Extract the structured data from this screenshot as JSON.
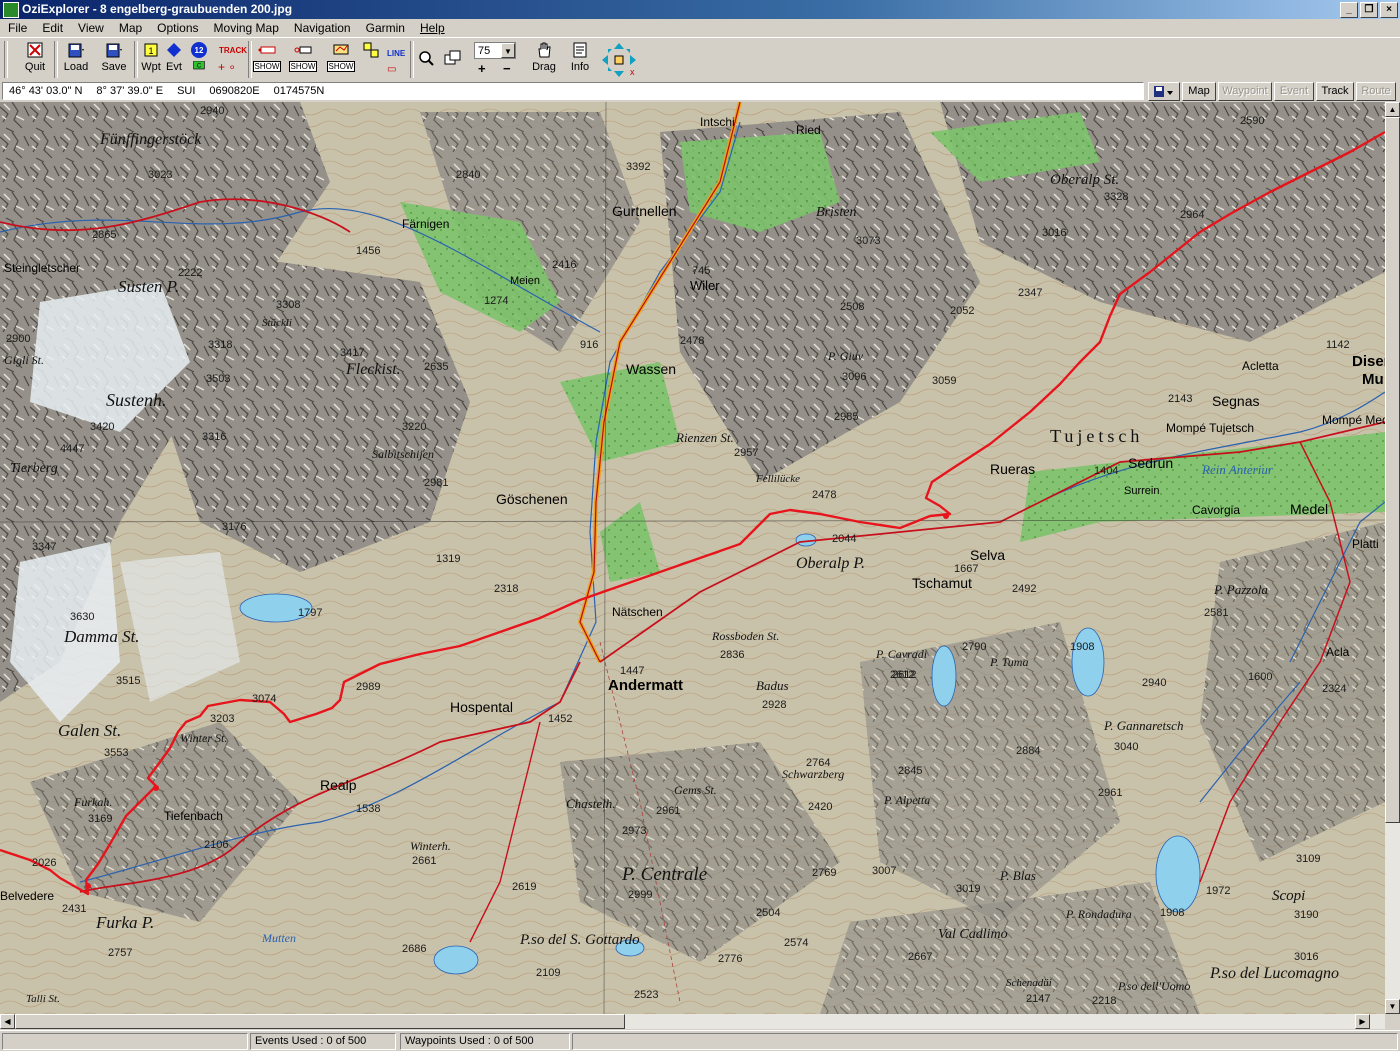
{
  "window": {
    "title": "OziExplorer - 8 engelberg-graubuenden 200.jpg"
  },
  "menu": [
    "File",
    "Edit",
    "View",
    "Map",
    "Options",
    "Moving Map",
    "Navigation",
    "Garmin",
    "Help"
  ],
  "toolbar": {
    "quit": "Quit",
    "load": "Load",
    "save": "Save",
    "wpt": "Wpt",
    "evt": "Evt",
    "track": "TRACK",
    "badge": "12",
    "show": "SHOW",
    "line": "LINE",
    "zoom": "75",
    "drag": "Drag",
    "info": "Info"
  },
  "coords": {
    "lat": "46° 43' 03.0\" N",
    "lon": "8° 37' 39.0\" E",
    "grid": "SUI",
    "east": "0690820E",
    "north": "0174575N"
  },
  "modes": {
    "map": "Map",
    "waypoint": "Waypoint",
    "event": "Event",
    "track": "Track",
    "route": "Route"
  },
  "status": {
    "events": "Events Used : 0 of 500",
    "waypoints": "Waypoints Used : 0 of 500"
  },
  "colors": {
    "track": "#e8141c",
    "titlebar": "#0a246a",
    "lake": "#8fd0ec",
    "forest": "#7dc36b"
  },
  "map": {
    "places": {
      "funffinger": "Fünffingerstöck",
      "steingletscher": "Steingletscher",
      "susten_p": "Susten P.",
      "gigli": "Gigli St.",
      "sustenh": "Sustenh.",
      "tierberg": "Tierberg",
      "farnigen": "Färnigen",
      "meien": "Meien",
      "fleckist": "Fleckist.",
      "intschi": "Intschi",
      "ried": "Ried",
      "gurtnellen": "Gurtnellen",
      "wiler": "Wiler",
      "wassen": "Wassen",
      "goschenen": "Göschenen",
      "sustli": "Stückli",
      "salbitschijen": "Salbitschijen",
      "damma": "Damma St.",
      "galen": "Galen St.",
      "winter": "Winter St.",
      "furkah": "Furkah.",
      "tiefenbach": "Tiefenbach",
      "realp": "Realp",
      "hospental": "Hospental",
      "andermatt": "Andermatt",
      "natschen": "Nätschen",
      "oberalp": "Oberalp P.",
      "tschamut": "Tschamut",
      "selva": "Selva",
      "rueras": "Rueras",
      "sedrun": "Sedrun",
      "surrein": "Surrein",
      "cavorgia": "Cavorgia",
      "medel": "Medel",
      "segnas": "Segnas",
      "acletta": "Acletta",
      "mompe_tujetsch": "Mompé Tujetsch",
      "mompe_medel": "Mompé Med.",
      "disentis": "Disentis",
      "mu": "Mu",
      "tujetsch": "Tujetsch",
      "furka": "Furka P.",
      "belvedere": "Belvedere",
      "winterh": "Winterh.",
      "chastelhorn": "Chastelh.",
      "gemsst": "Gems St.",
      "p_centrale": "P. Centrale",
      "gottardo": "P.so del S. Gottardo",
      "rossboden": "Rossboden St.",
      "badus": "Badus",
      "schwarzberg": "Schwarzberg",
      "p_alpetta": "P. Alpetta",
      "p_cavradi": "P. Cavradi",
      "p_tuma": "P. Tuma",
      "p_gannaretsch": "P. Gannaretsch",
      "p_pazzola": "P. Pazzola",
      "p_blas": "P. Blas",
      "platti": "Platti",
      "acla": "Acla",
      "scopi": "Scopi",
      "lucomagno": "P.so del Lucomagno",
      "rein": "Rein Anteriur",
      "oberalp_st": "Oberalp St.",
      "p_giuv": "P. Giuv",
      "rienzen": "Rienzen St.",
      "fellilucke": "Fellilücke",
      "muttenhorn": "Mutten",
      "val_cadlimo": "Val Cadlimo",
      "tallist": "Talli St.",
      "pdellomo": "P.so dell'Uomo",
      "schenadui": "Schenadüi",
      "rondadura": "P. Rondadura",
      "bristen": "Bristen"
    },
    "elev": [
      "2940",
      "3023",
      "2865",
      "2222",
      "2900",
      "3318",
      "3308",
      "1456",
      "1274",
      "3417",
      "2635",
      "3503",
      "3316",
      "3420",
      "4447",
      "3220",
      "2981",
      "3176",
      "3347",
      "1319",
      "1797",
      "2318",
      "3630",
      "2989",
      "3515",
      "3074",
      "3203",
      "3553",
      "3169",
      "2431",
      "2026",
      "2757",
      "1538",
      "2106",
      "1447",
      "1452",
      "2961",
      "2973",
      "2999",
      "2661",
      "2619",
      "2686",
      "2109",
      "2523",
      "2776",
      "2504",
      "2574",
      "2667",
      "2769",
      "2420",
      "2764",
      "2928",
      "2836",
      "2612",
      "2790",
      "2492",
      "2581",
      "2940",
      "1600",
      "2324",
      "3040",
      "2961",
      "1908",
      "1908",
      "3109",
      "3190",
      "1972",
      "3016",
      "3019",
      "3007",
      "2218",
      "2147",
      "3392",
      "2840",
      "2416",
      "745",
      "916",
      "2478",
      "3073",
      "2508",
      "2052",
      "3096",
      "2985",
      "2957",
      "2478",
      "2044",
      "1667",
      "1404",
      "2143",
      "1142",
      "3059",
      "3016",
      "2347",
      "3328",
      "2964",
      "2590",
      "2884",
      "2845",
      "2612"
    ]
  }
}
